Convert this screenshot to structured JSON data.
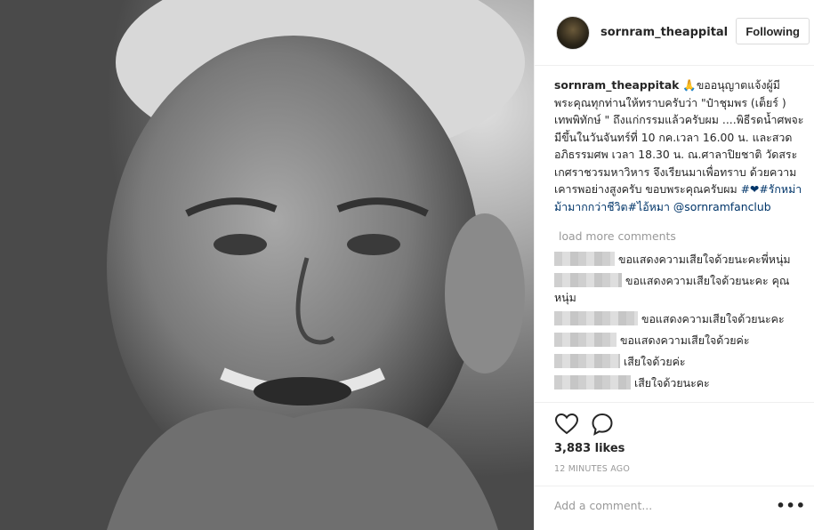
{
  "post": {
    "image_alt": "photo-old-man"
  },
  "header": {
    "username": "sornram_theappital",
    "follow_label": "Following"
  },
  "caption": {
    "username": "sornram_theappitak",
    "emoji": "🙏",
    "text_1": "ขออนุญาตแจ้งผู้มีพระคุณทุกท่านให้ทราบครับว่า \"ป๋าชุมพร (เต็ยร์ ) เทพพิทักษ์ \" ถึงแก่กรรมแล้วครับผม ....พิธีรดน้ำศพจะมีขึ้นในวันจันทร์ที่ 10 กค.เวลา 16.00 น. และสวดอภิธรรมศพ เวลา 18.30 น. ณ.ศาลาปิยชาติ วัดสระเกศราชวรมหาวิหาร จึงเรียนมาเพื่อทราบ ด้วยความเคารพอย่างสูงครับ ขอบพระคุณครับผม ",
    "hashtag": "#❤#รักหม่าม้ามากกว่าชีวิต#ไอ้หมา",
    "mention": "@sornramfanclub"
  },
  "comments": {
    "load_more": "load more comments",
    "items": [
      {
        "text": "ขอแสดงความเสียใจด้วยนะคะพี่หนุ่ม"
      },
      {
        "text": "ขอแสดงความเสียใจด้วยนะคะ คุณหนุ่ม"
      },
      {
        "text": "ขอแสดงความเสียใจด้วยนะคะ"
      },
      {
        "text": "ขอแสดงความเสียใจด้วยค่ะ"
      },
      {
        "text": "เสียใจด้วยค่ะ"
      },
      {
        "text": "เสียใจด้วยนะคะ"
      }
    ]
  },
  "actions": {
    "likes": "3,883 likes",
    "time": "12 MINUTES AGO",
    "heart_icon": "heart-icon",
    "comment_icon": "comment-icon"
  },
  "add_comment": {
    "placeholder": "Add a comment...",
    "more": "•••"
  }
}
